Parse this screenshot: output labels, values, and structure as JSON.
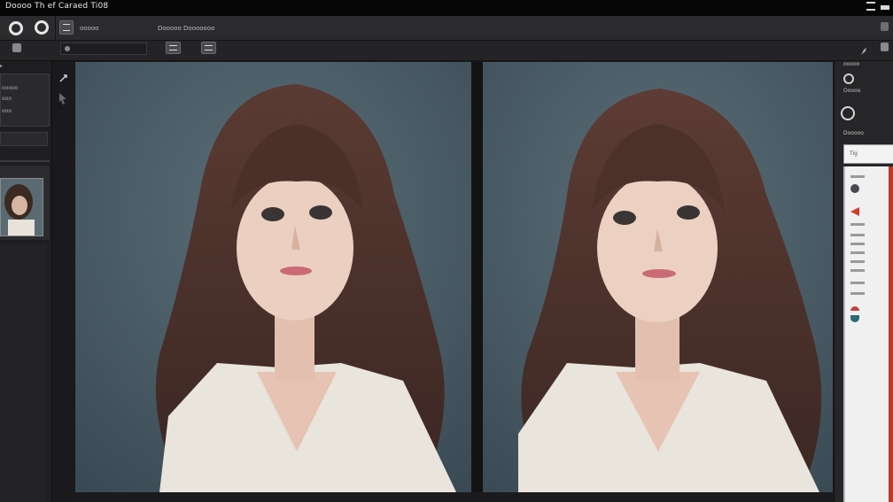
{
  "window": {
    "title": "Doooo Th ef Caraed Ti08",
    "controls": [
      "minimize-icon",
      "window-toggle-icon"
    ]
  },
  "toolbar": {
    "tool_labels": [
      "ooooo",
      "Dooooo Dooooooo"
    ],
    "icons": [
      "ring-icon",
      "ring-icon",
      "layout-icon",
      "grid-icon",
      "grid-icon",
      "brush-icon",
      "window-icon"
    ]
  },
  "left_panel": {
    "header": "▸",
    "list_items": [
      "ooooo",
      "ooo",
      "ooo"
    ],
    "thumbnail": "portrait-thumbnail"
  },
  "tools": [
    "arrow-tool-icon",
    "select-tool-icon"
  ],
  "canvas": {
    "left_image": "portrait-before",
    "right_image": "portrait-after"
  },
  "right_panel": {
    "label1": "ooooo",
    "label2": "Ooooo",
    "label3": "Dooooo",
    "search_value": "Tig",
    "accent_color": "#b93a2a"
  }
}
